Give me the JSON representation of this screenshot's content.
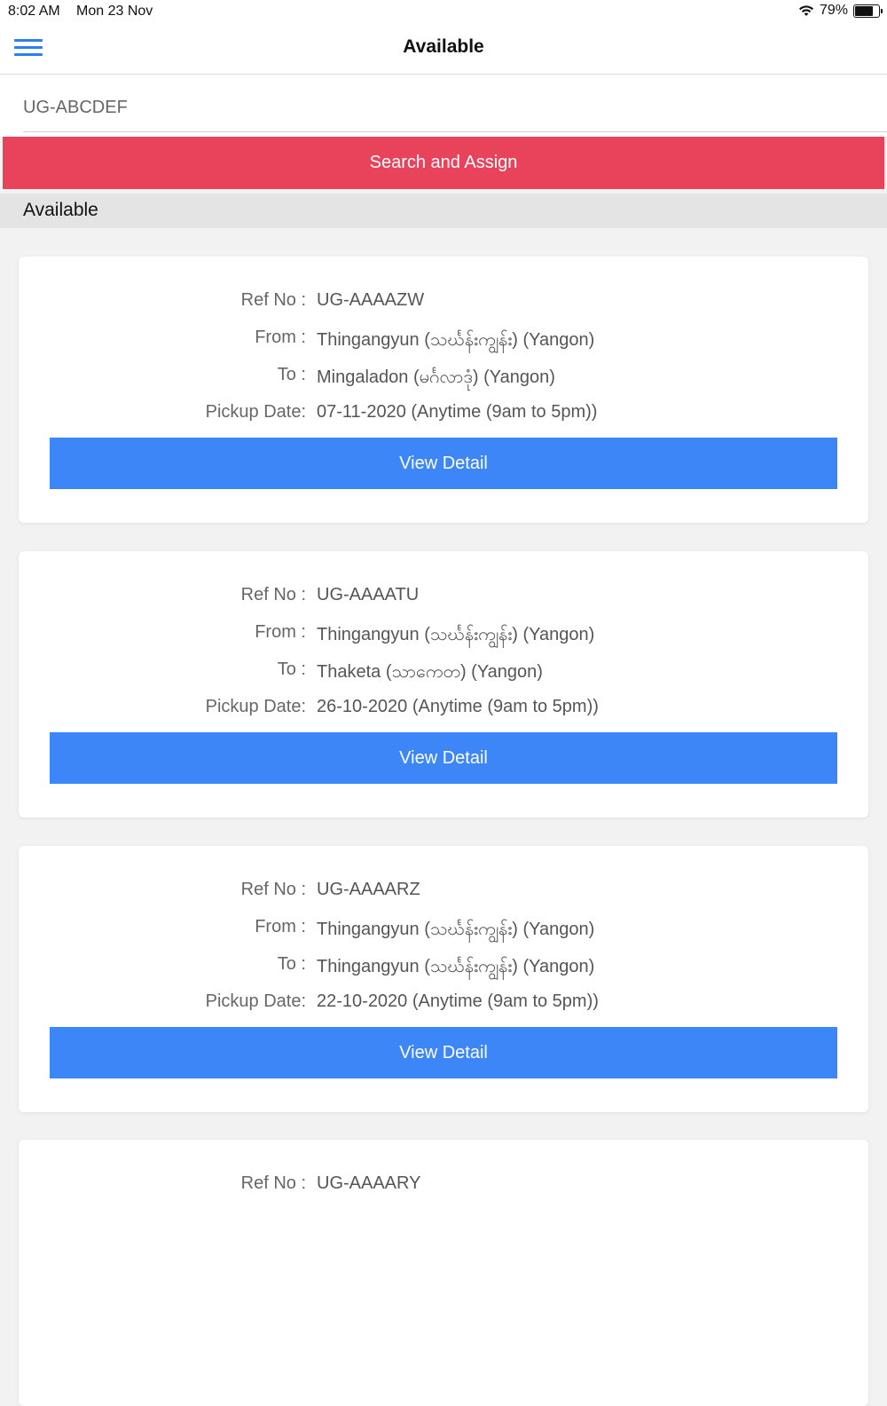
{
  "status_bar": {
    "time": "8:02 AM",
    "date": "Mon 23 Nov",
    "battery": "79%",
    "battery_level": 0.79
  },
  "nav": {
    "title": "Available"
  },
  "search": {
    "value": "UG-ABCDEF",
    "button_label": "Search and Assign"
  },
  "section": {
    "title": "Available"
  },
  "labels": {
    "ref": "Ref No :",
    "from": "From :",
    "to": "To :",
    "pickup": "Pickup Date:",
    "view": "View Detail"
  },
  "cards": [
    {
      "ref": "UG-AAAAZW",
      "from": "Thingangyun (သင်္ဃန်းကျွန်း) (Yangon)",
      "to": "Mingaladon (မင်္ဂလာဒုံ) (Yangon)",
      "pickup": "07-11-2020 (Anytime (9am to 5pm))"
    },
    {
      "ref": "UG-AAAATU",
      "from": "Thingangyun (သင်္ဃန်းကျွန်း) (Yangon)",
      "to": "Thaketa (သာကေတ) (Yangon)",
      "pickup": "26-10-2020 (Anytime (9am to 5pm))"
    },
    {
      "ref": "UG-AAAARZ",
      "from": "Thingangyun (သင်္ဃန်းကျွန်း) (Yangon)",
      "to": "Thingangyun (သင်္ဃန်းကျွန်း) (Yangon)",
      "pickup": "22-10-2020 (Anytime (9am to 5pm))"
    },
    {
      "ref": "UG-AAAARY",
      "from": "",
      "to": "",
      "pickup": ""
    }
  ]
}
